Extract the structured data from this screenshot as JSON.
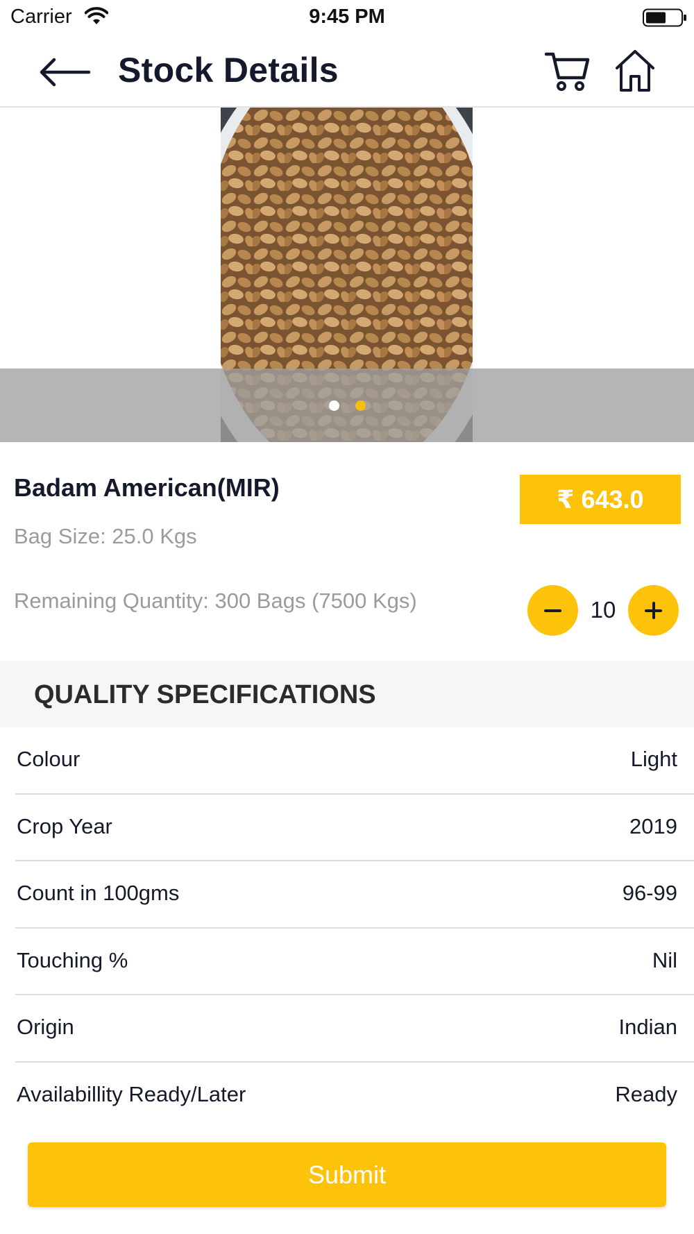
{
  "status_bar": {
    "carrier": "Carrier",
    "time": "9:45 PM"
  },
  "header": {
    "title": "Stock Details",
    "icons": [
      "back-arrow-icon",
      "cart-icon",
      "home-icon"
    ]
  },
  "carousel": {
    "image": "almonds in a white bowl",
    "slide_count": 2,
    "active_slide": 2,
    "active_dot_color": "#f6bd12"
  },
  "product": {
    "name": "Badam American(MIR)",
    "price": "₹ 643.0",
    "bag_size": "Bag Size: 25.0 Kgs",
    "remaining_quantity": "Remaining Quantity: 300 Bags (7500 Kgs)",
    "quantity": "10"
  },
  "quality": {
    "title": "QUALITY SPECIFICATIONS",
    "specs": [
      {
        "label": "Colour",
        "value": "Light"
      },
      {
        "label": "Crop Year",
        "value": "2019"
      },
      {
        "label": "Count in 100gms",
        "value": "96-99"
      },
      {
        "label": "Touching %",
        "value": "Nil"
      },
      {
        "label": "Origin",
        "value": "Indian"
      },
      {
        "label": "Availabillity Ready/Later",
        "value": "Ready"
      }
    ]
  },
  "actions": {
    "submit_label": "Submit"
  },
  "colors": {
    "accent": "#fcc30a",
    "text": "#141a2b",
    "muted": "#9b9b9b"
  }
}
